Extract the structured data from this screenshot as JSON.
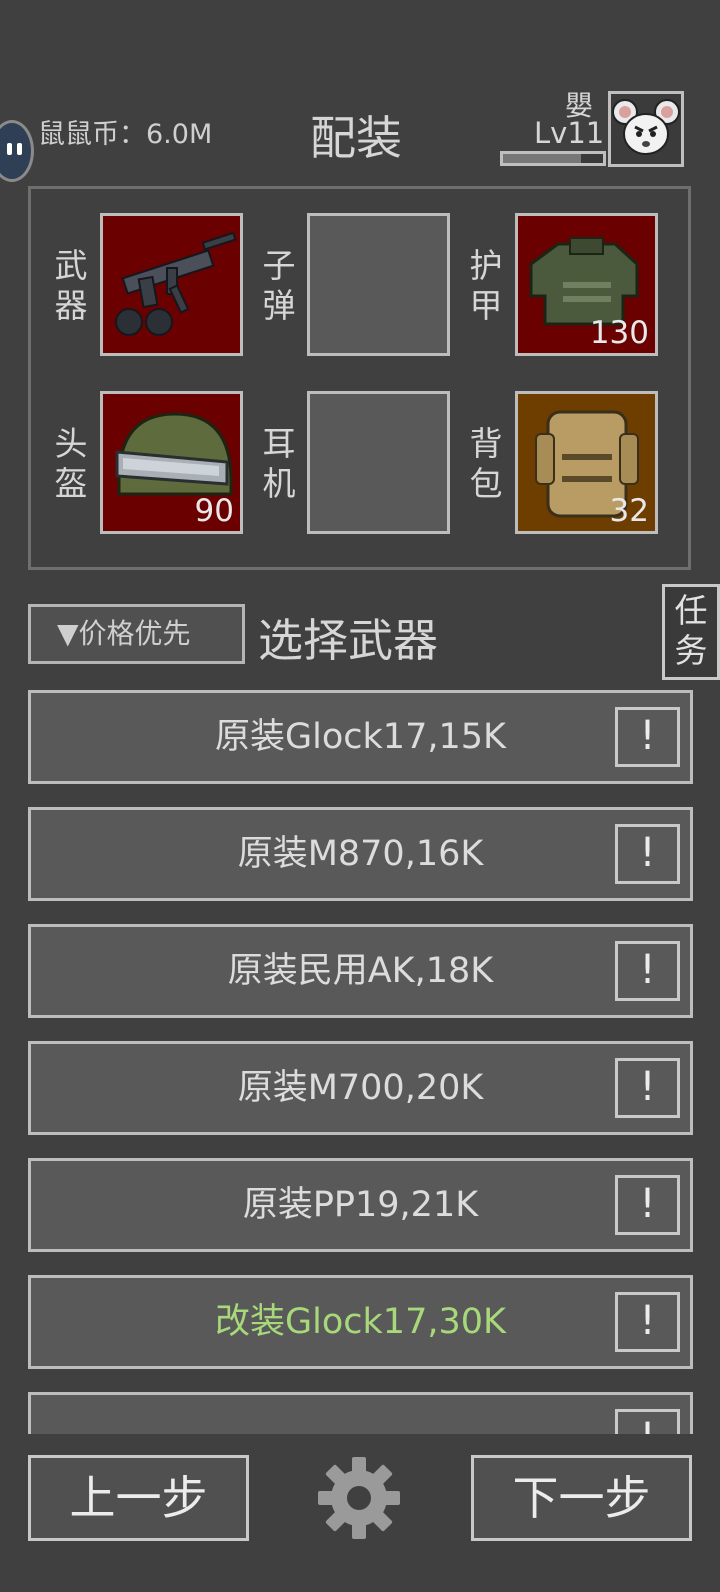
{
  "header": {
    "coins_label": "鼠鼠币：6.0M",
    "title": "配装",
    "player_name": "嬰",
    "level": "Lv11",
    "xp_fraction": 0.78
  },
  "loadout": {
    "weapon": {
      "label": "武器",
      "value": ""
    },
    "ammo": {
      "label": "子弹",
      "value": ""
    },
    "armor": {
      "label": "护甲",
      "value": "130"
    },
    "helmet": {
      "label": "头盔",
      "value": "90"
    },
    "headset": {
      "label": "耳机",
      "value": ""
    },
    "backpack": {
      "label": "背包",
      "value": "32"
    }
  },
  "sort_button": "▼价格优先",
  "select_title": "选择武器",
  "task_button": "任务",
  "weapons": [
    {
      "label": "原装Glock17,15K",
      "info": "!"
    },
    {
      "label": "原装M870,16K",
      "info": "!"
    },
    {
      "label": "原装民用AK,18K",
      "info": "!"
    },
    {
      "label": "原装M700,20K",
      "info": "!"
    },
    {
      "label": "原装PP19,21K",
      "info": "!"
    },
    {
      "label": "改装Glock17,30K",
      "info": "!"
    },
    {
      "label": "",
      "info": "!"
    }
  ],
  "footer": {
    "prev": "上一步",
    "next": "下一步"
  },
  "colors": {
    "background": "#404040",
    "slot_red": "#6a0000",
    "slot_brown": "#6e3d00",
    "highlight_green": "#a7d87a"
  }
}
